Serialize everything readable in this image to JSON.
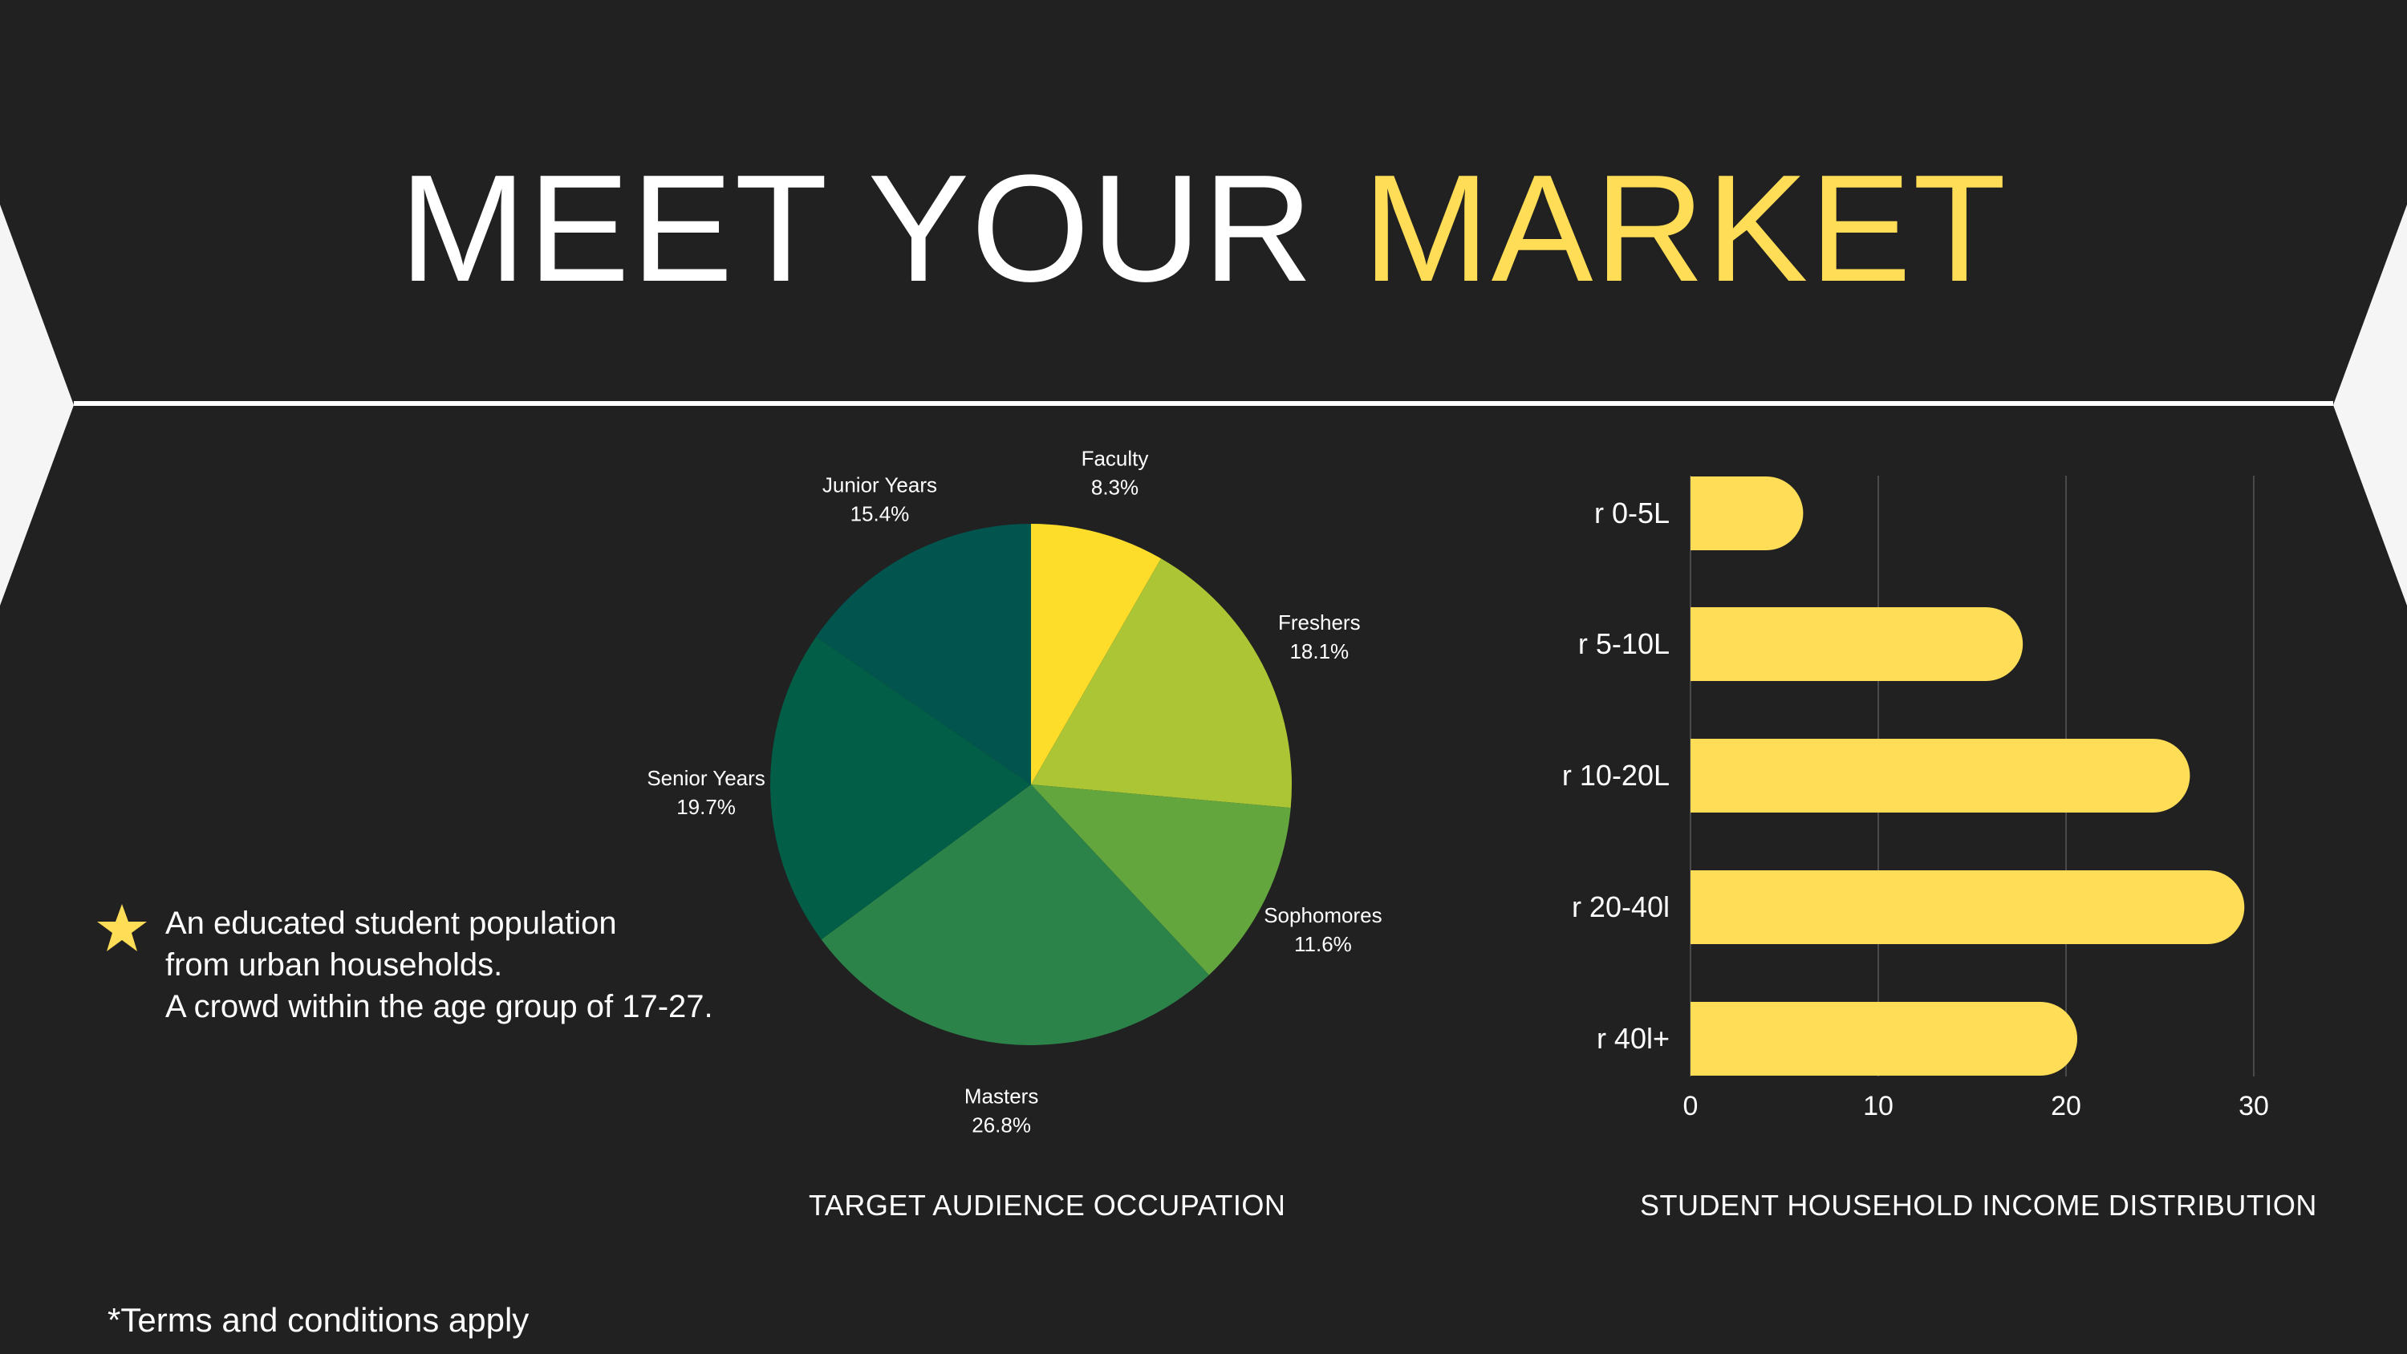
{
  "title": {
    "part1": "MEET YOUR",
    "part2": "MARKET"
  },
  "colors": {
    "background": "#212121",
    "accent": "#ffdd57",
    "text": "#ffffff"
  },
  "bullet": {
    "icon": "star-icon",
    "lines": [
      "An educated student population",
      "from urban households.",
      "A crowd within the age group of 17-27."
    ]
  },
  "footer": {
    "terms": "*Terms and conditions apply"
  },
  "chart_data": [
    {
      "type": "pie",
      "caption": "TARGET AUDIENCE OCCUPATION",
      "slices": [
        {
          "label": "Faculty",
          "value": 8.3,
          "value_label": "8.3%",
          "color": "#fddd2a"
        },
        {
          "label": "Freshers",
          "value": 18.1,
          "value_label": "18.1%",
          "color": "#abc535"
        },
        {
          "label": "Sophomores",
          "value": 11.6,
          "value_label": "11.6%",
          "color": "#64a63e"
        },
        {
          "label": "Masters",
          "value": 26.8,
          "value_label": "26.8%",
          "color": "#2c834a"
        },
        {
          "label": "Senior Years",
          "value": 19.7,
          "value_label": "19.7%",
          "color": "#025e46"
        },
        {
          "label": "Junior Years",
          "value": 15.4,
          "value_label": "15.4%",
          "color": "#02554e"
        }
      ]
    },
    {
      "type": "bar",
      "orientation": "horizontal",
      "caption": "STUDENT HOUSEHOLD INCOME DISTRIBUTION",
      "categories": [
        "r 0-5L",
        "r 5-10L",
        "r 10-20L",
        "r 20-40l",
        "r 40l+"
      ],
      "values": [
        6,
        17.7,
        26.6,
        29.5,
        20.6
      ],
      "xlim": [
        0,
        30
      ],
      "xticks": [
        0,
        10,
        20,
        30
      ],
      "grid": true,
      "bar_color": "#ffdd57"
    }
  ]
}
